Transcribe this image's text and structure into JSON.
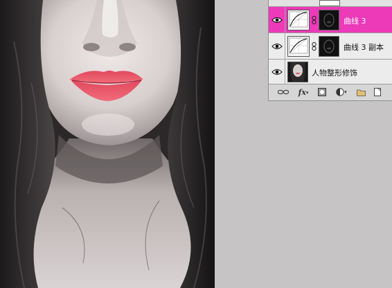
{
  "canvas": {
    "description_icon": "portrait-photo"
  },
  "layers": {
    "items": [
      {
        "name": "曲线 3",
        "type": "curves-adjustment",
        "selected": true,
        "visible": true,
        "has_mask": true
      },
      {
        "name": "曲线 3 副本",
        "type": "curves-adjustment",
        "selected": false,
        "visible": true,
        "has_mask": true
      },
      {
        "name": "人物整形修饰",
        "type": "image",
        "selected": false,
        "visible": true,
        "has_mask": false
      }
    ],
    "toolbar": {
      "link_icon": "link-layers-icon",
      "fx_label": "fx",
      "mask_icon": "add-mask-icon",
      "adjustment_icon": "new-adjustment-icon",
      "group_icon": "new-group-icon",
      "new_layer_icon": "new-layer-icon"
    }
  },
  "colors": {
    "selected_layer": "#ec3ab9",
    "workspace": "#c6c4c5",
    "panel": "#d6d6d6"
  }
}
